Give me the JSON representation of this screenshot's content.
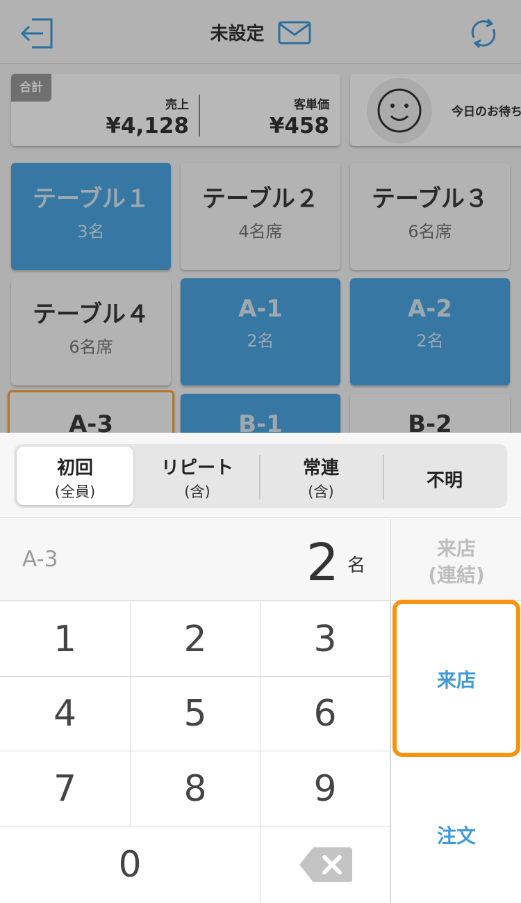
{
  "header": {
    "title": "未設定"
  },
  "summary": {
    "badge": "合計",
    "sales_label": "売上",
    "sales_value": "¥4,128",
    "avg_label": "客単価",
    "avg_value": "¥458"
  },
  "waiting": {
    "label": "今日のお待ち"
  },
  "tables": [
    {
      "name": "テーブル１",
      "seats": "3名",
      "state": "occupied"
    },
    {
      "name": "テーブル２",
      "seats": "4名席",
      "state": "empty"
    },
    {
      "name": "テーブル３",
      "seats": "6名席",
      "state": "empty"
    },
    {
      "name": "テーブル４",
      "seats": "6名席",
      "state": "empty"
    },
    {
      "name": "A-1",
      "seats": "2名",
      "state": "occupied"
    },
    {
      "name": "A-2",
      "seats": "2名",
      "state": "occupied"
    },
    {
      "name": "A-3",
      "seats": "",
      "state": "selected"
    },
    {
      "name": "B-1",
      "seats": "",
      "state": "occupied"
    },
    {
      "name": "B-2",
      "seats": "",
      "state": "empty"
    }
  ],
  "segment": {
    "options": [
      {
        "main": "初回",
        "sub": "(全員)"
      },
      {
        "main": "リピート",
        "sub": "(含)"
      },
      {
        "main": "常連",
        "sub": "(含)"
      },
      {
        "main": "不明",
        "sub": ""
      }
    ],
    "selected_index": 0
  },
  "entry": {
    "table": "A-3",
    "count": "2",
    "unit": "名"
  },
  "keypad": {
    "keys": [
      "1",
      "2",
      "3",
      "4",
      "5",
      "6",
      "7",
      "8",
      "9",
      "0"
    ]
  },
  "actions": {
    "visit_linked_line1": "来店",
    "visit_linked_line2": "(連結)",
    "visit": "来店",
    "order": "注文"
  },
  "colors": {
    "accent_blue": "#3e9ad8",
    "occupied_blue": "#4ba6e2",
    "highlight_orange": "#f7930e"
  }
}
